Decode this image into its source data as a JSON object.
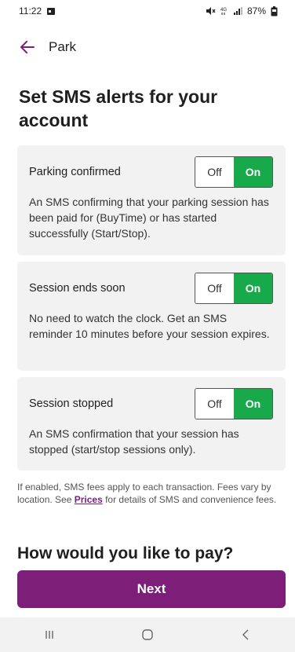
{
  "status_bar": {
    "time": "11:22",
    "battery": "87%",
    "network": "4G"
  },
  "header": {
    "title": "Park",
    "back_icon": "back-arrow-icon"
  },
  "heading": "Set SMS alerts for your account",
  "alerts": [
    {
      "title": "Parking confirmed",
      "description": "An SMS confirming that your parking session has been paid for (BuyTime) or has started successfully (Start/Stop).",
      "off_label": "Off",
      "on_label": "On",
      "state": "on"
    },
    {
      "title": "Session ends soon",
      "description": "No need to watch the clock. Get an SMS reminder 10 minutes before your session expires.",
      "off_label": "Off",
      "on_label": "On",
      "state": "on"
    },
    {
      "title": "Session stopped",
      "description": "An SMS confirmation that your session has stopped (start/stop sessions only).",
      "off_label": "Off",
      "on_label": "On",
      "state": "on"
    }
  ],
  "fees": {
    "before": "If enabled, SMS fees apply to each transaction. Fees vary by location. See ",
    "link": "Prices",
    "after": " for details of SMS and convenience fees."
  },
  "pay_heading": "How would you like to pay?",
  "next_label": "Next",
  "colors": {
    "accent": "#7d1e78",
    "toggle_on": "#18a94b",
    "card_bg": "#f2f2f2"
  }
}
